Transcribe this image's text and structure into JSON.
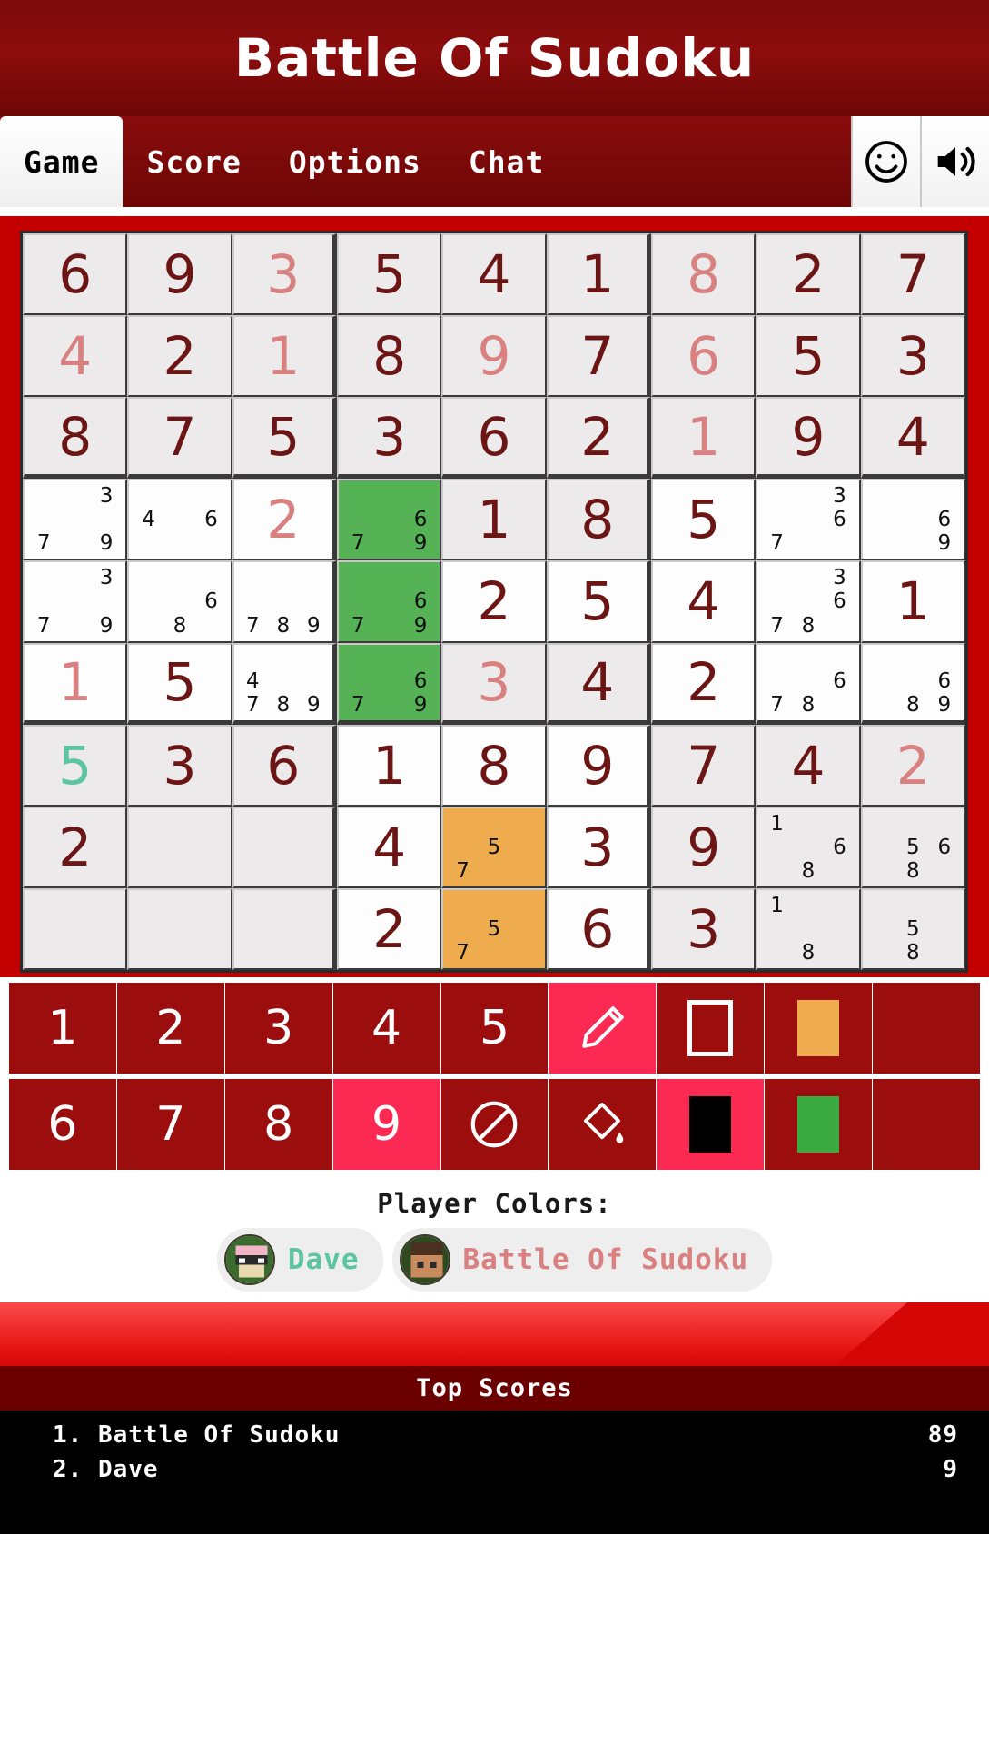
{
  "header": {
    "title": "Battle Of Sudoku"
  },
  "tabs": [
    {
      "label": "Game",
      "active": true
    },
    {
      "label": "Score",
      "active": false
    },
    {
      "label": "Options",
      "active": false
    },
    {
      "label": "Chat",
      "active": false
    }
  ],
  "tab_icons": [
    {
      "name": "smiley-icon",
      "label": "smiley"
    },
    {
      "name": "sound-icon",
      "label": "sound"
    }
  ],
  "colors": {
    "given": "#6b1515",
    "player1": "#d98080",
    "player2": "#5cc4a0",
    "highlight_green": "#55b356",
    "highlight_orange": "#eeac4e",
    "brand_red": "#9c0d0d",
    "active_pink": "#fc2a52",
    "title_bar": "#7d0a0a"
  },
  "board": {
    "rows": [
      [
        {
          "v": "6",
          "c": "given"
        },
        {
          "v": "9",
          "c": "given"
        },
        {
          "v": "3",
          "c": "p1"
        },
        {
          "v": "5",
          "c": "given"
        },
        {
          "v": "4",
          "c": "given"
        },
        {
          "v": "1",
          "c": "given"
        },
        {
          "v": "8",
          "c": "p1"
        },
        {
          "v": "2",
          "c": "given"
        },
        {
          "v": "7",
          "c": "given"
        }
      ],
      [
        {
          "v": "4",
          "c": "p1"
        },
        {
          "v": "2",
          "c": "given"
        },
        {
          "v": "1",
          "c": "p1"
        },
        {
          "v": "8",
          "c": "given"
        },
        {
          "v": "9",
          "c": "p1"
        },
        {
          "v": "7",
          "c": "given"
        },
        {
          "v": "6",
          "c": "p1"
        },
        {
          "v": "5",
          "c": "given"
        },
        {
          "v": "3",
          "c": "given"
        }
      ],
      [
        {
          "v": "8",
          "c": "given"
        },
        {
          "v": "7",
          "c": "given"
        },
        {
          "v": "5",
          "c": "given"
        },
        {
          "v": "3",
          "c": "given"
        },
        {
          "v": "6",
          "c": "given"
        },
        {
          "v": "2",
          "c": "given"
        },
        {
          "v": "1",
          "c": "p1"
        },
        {
          "v": "9",
          "c": "given"
        },
        {
          "v": "4",
          "c": "given"
        }
      ],
      [
        {
          "p": [
            3,
            7,
            9
          ],
          "bg": "white"
        },
        {
          "p": [
            4,
            6
          ],
          "bg": "white"
        },
        {
          "v": "2",
          "c": "p1",
          "bg": "white"
        },
        {
          "p": [
            6,
            7,
            9
          ],
          "bg": "green"
        },
        {
          "v": "1",
          "c": "given"
        },
        {
          "v": "8",
          "c": "given"
        },
        {
          "v": "5",
          "c": "given",
          "bg": "white"
        },
        {
          "p": [
            3,
            6,
            7
          ],
          "bg": "white"
        },
        {
          "p": [
            6,
            9
          ],
          "bg": "white"
        }
      ],
      [
        {
          "p": [
            3,
            7,
            9
          ],
          "bg": "white"
        },
        {
          "p": [
            6,
            8
          ],
          "bg": "white"
        },
        {
          "p": [
            7,
            8,
            9
          ],
          "bg": "white"
        },
        {
          "p": [
            6,
            7,
            9
          ],
          "bg": "green"
        },
        {
          "v": "2",
          "c": "given",
          "bg": "white"
        },
        {
          "v": "5",
          "c": "given",
          "bg": "white"
        },
        {
          "v": "4",
          "c": "given",
          "bg": "white"
        },
        {
          "p": [
            3,
            6,
            7,
            8
          ],
          "bg": "white"
        },
        {
          "v": "1",
          "c": "given",
          "bg": "white"
        }
      ],
      [
        {
          "v": "1",
          "c": "p1",
          "bg": "white"
        },
        {
          "v": "5",
          "c": "given",
          "bg": "white"
        },
        {
          "p": [
            4,
            7,
            8,
            9
          ],
          "bg": "white"
        },
        {
          "p": [
            6,
            7,
            9
          ],
          "bg": "green"
        },
        {
          "v": "3",
          "c": "p1"
        },
        {
          "v": "4",
          "c": "given"
        },
        {
          "v": "2",
          "c": "given",
          "bg": "white"
        },
        {
          "p": [
            6,
            7,
            8
          ],
          "bg": "white"
        },
        {
          "p": [
            6,
            8,
            9
          ],
          "bg": "white"
        }
      ],
      [
        {
          "v": "5",
          "c": "p2"
        },
        {
          "v": "3",
          "c": "given"
        },
        {
          "v": "6",
          "c": "given"
        },
        {
          "v": "1",
          "c": "given",
          "bg": "white"
        },
        {
          "v": "8",
          "c": "given",
          "bg": "white"
        },
        {
          "v": "9",
          "c": "given",
          "bg": "white"
        },
        {
          "v": "7",
          "c": "given"
        },
        {
          "v": "4",
          "c": "given"
        },
        {
          "v": "2",
          "c": "p1"
        }
      ],
      [
        {
          "v": "2",
          "c": "given"
        },
        {
          "v": "",
          "c": "given"
        },
        {
          "v": "",
          "c": "given"
        },
        {
          "v": "4",
          "c": "given",
          "bg": "white"
        },
        {
          "p": [
            5,
            7
          ],
          "bg": "orange"
        },
        {
          "v": "3",
          "c": "given",
          "bg": "white"
        },
        {
          "v": "9",
          "c": "given"
        },
        {
          "p": [
            1,
            6,
            8
          ]
        },
        {
          "p": [
            5,
            6,
            8
          ]
        }
      ],
      [
        {
          "v": "",
          "c": "given"
        },
        {
          "v": "",
          "c": "given"
        },
        {
          "v": "",
          "c": "given"
        },
        {
          "v": "2",
          "c": "given",
          "bg": "white"
        },
        {
          "p": [
            5,
            7
          ],
          "bg": "orange"
        },
        {
          "v": "6",
          "c": "given",
          "bg": "white"
        },
        {
          "v": "3",
          "c": "given"
        },
        {
          "p": [
            1,
            8
          ]
        },
        {
          "p": [
            5,
            8
          ]
        }
      ]
    ]
  },
  "numpad": {
    "row1": [
      {
        "label": "1",
        "name": "numpad-1",
        "active": false
      },
      {
        "label": "2",
        "name": "numpad-2",
        "active": false
      },
      {
        "label": "3",
        "name": "numpad-3",
        "active": false
      },
      {
        "label": "4",
        "name": "numpad-4",
        "active": false
      },
      {
        "label": "5",
        "name": "numpad-5",
        "active": false
      },
      {
        "label": "",
        "name": "pencil-icon",
        "icon": "pencil",
        "active": true
      },
      {
        "label": "",
        "name": "square-outline-icon",
        "icon": "square",
        "active": false
      },
      {
        "label": "",
        "name": "orange-swatch",
        "icon": "swatch-orange",
        "active": false
      },
      {
        "label": "",
        "name": "numpad-spacer-1",
        "icon": "none",
        "active": false
      }
    ],
    "row2": [
      {
        "label": "6",
        "name": "numpad-6",
        "active": false
      },
      {
        "label": "7",
        "name": "numpad-7",
        "active": false
      },
      {
        "label": "8",
        "name": "numpad-8",
        "active": false
      },
      {
        "label": "9",
        "name": "numpad-9",
        "active": true
      },
      {
        "label": "",
        "name": "no-entry-icon",
        "icon": "noentry",
        "active": false
      },
      {
        "label": "",
        "name": "paint-bucket-icon",
        "icon": "bucket",
        "active": false
      },
      {
        "label": "",
        "name": "black-swatch",
        "icon": "swatch-black",
        "active": true
      },
      {
        "label": "",
        "name": "green-swatch",
        "icon": "swatch-green",
        "active": false
      },
      {
        "label": "",
        "name": "numpad-spacer-2",
        "icon": "none",
        "active": false
      }
    ]
  },
  "player_colors": {
    "title": "Player Colors:",
    "players": [
      {
        "name": "Dave",
        "color": "#5cc4a0"
      },
      {
        "name": "Battle Of Sudoku",
        "color": "#d98080"
      }
    ]
  },
  "top_scores": {
    "title": "Top Scores",
    "rows": [
      {
        "rank": "1. Battle Of Sudoku",
        "score": "89"
      },
      {
        "rank": "2. Dave",
        "score": "9"
      }
    ]
  }
}
